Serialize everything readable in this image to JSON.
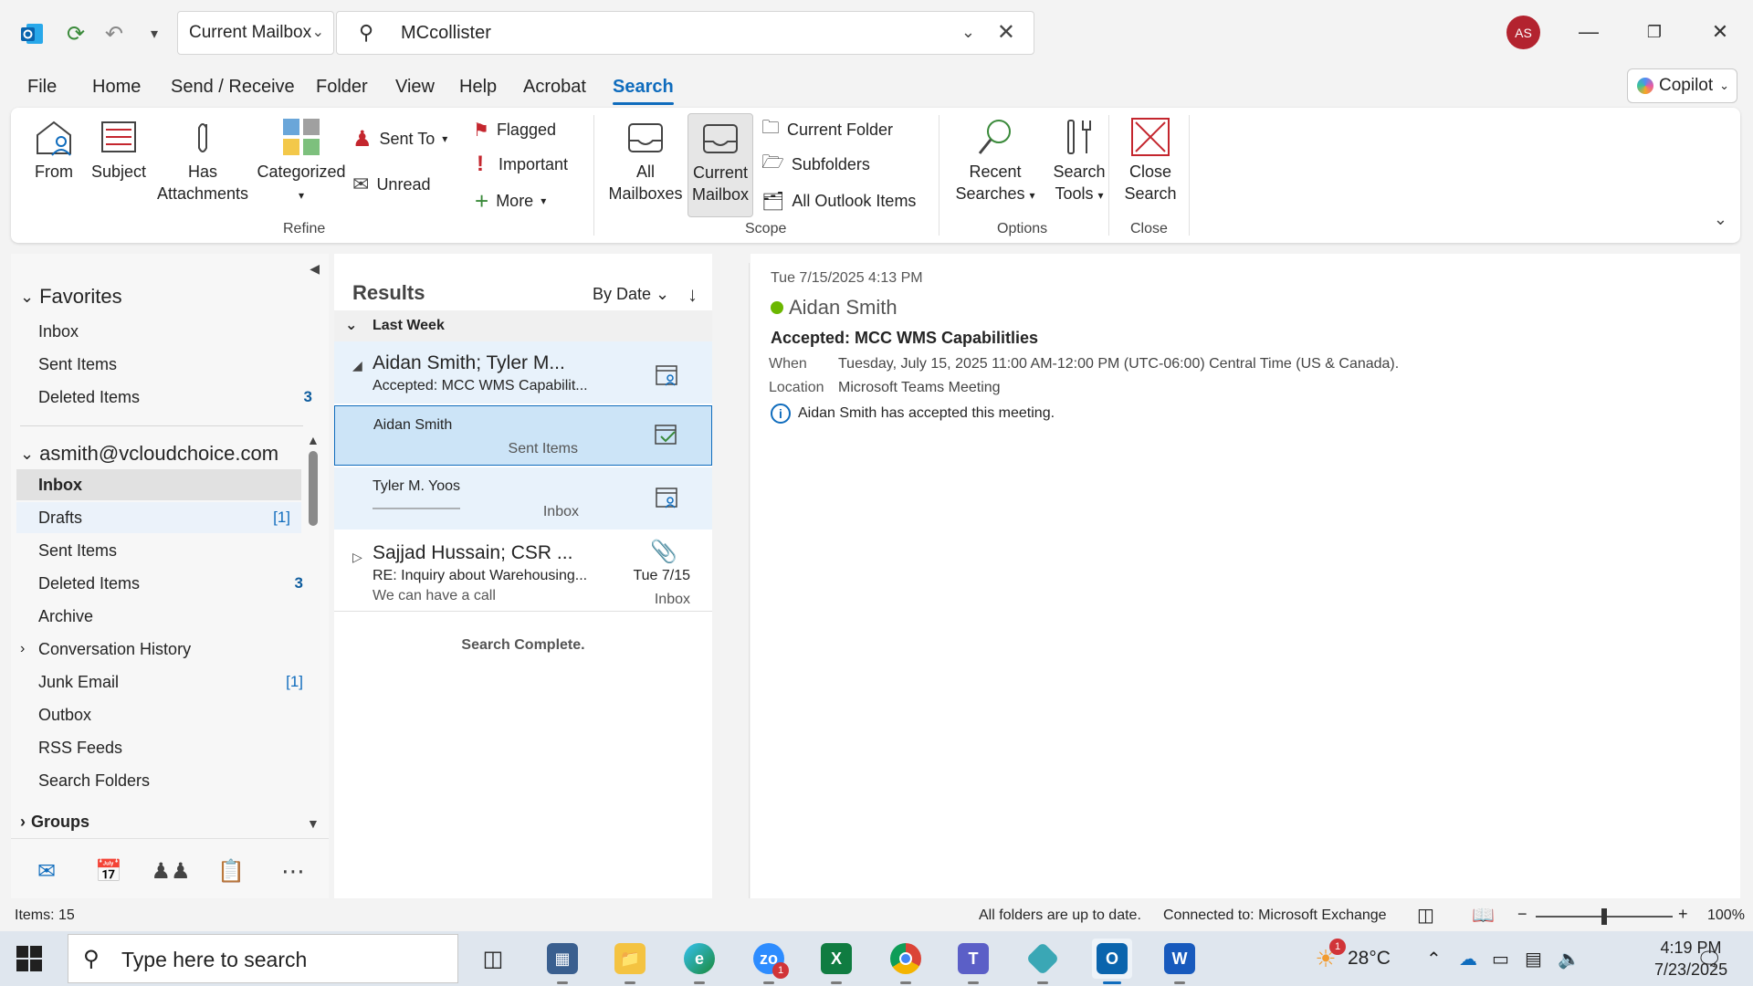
{
  "titlebar": {
    "scope_value": "Current Mailbox",
    "search_value": "MCcollister",
    "avatar_initials": "AS"
  },
  "menu": {
    "tabs": [
      "File",
      "Home",
      "Send / Receive",
      "Folder",
      "View",
      "Help",
      "Acrobat",
      "Search"
    ],
    "active_tab": "Search",
    "copilot_label": "Copilot"
  },
  "ribbon": {
    "refine": {
      "from": "From",
      "subject": "Subject",
      "has_attachments_1": "Has",
      "has_attachments_2": "Attachments",
      "categorized": "Categorized",
      "sent_to": "Sent To",
      "unread": "Unread",
      "flagged": "Flagged",
      "important": "Important",
      "more": "More",
      "label": "Refine"
    },
    "scope": {
      "all_mailboxes_1": "All",
      "all_mailboxes_2": "Mailboxes",
      "current_mailbox_1": "Current",
      "current_mailbox_2": "Mailbox",
      "current_folder": "Current Folder",
      "subfolders": "Subfolders",
      "all_outlook_items": "All Outlook Items",
      "label": "Scope"
    },
    "options": {
      "recent_searches_1": "Recent",
      "recent_searches_2": "Searches",
      "search_tools_1": "Search",
      "search_tools_2": "Tools",
      "label": "Options"
    },
    "close": {
      "close_search_1": "Close",
      "close_search_2": "Search",
      "label": "Close"
    }
  },
  "folders": {
    "favorites_header": "Favorites",
    "favorites": [
      {
        "name": "Inbox",
        "count": ""
      },
      {
        "name": "Sent Items",
        "count": ""
      },
      {
        "name": "Deleted Items",
        "count": "3"
      }
    ],
    "account_header": "asmith@vcloudchoice.com",
    "account": [
      {
        "name": "Inbox",
        "count": ""
      },
      {
        "name": "Drafts",
        "count": "[1]"
      },
      {
        "name": "Sent Items",
        "count": ""
      },
      {
        "name": "Deleted Items",
        "count": "3"
      },
      {
        "name": "Archive",
        "count": ""
      },
      {
        "name": "Conversation History",
        "count": ""
      },
      {
        "name": "Junk Email",
        "count": "[1]"
      },
      {
        "name": "Outbox",
        "count": ""
      },
      {
        "name": "RSS Feeds",
        "count": ""
      },
      {
        "name": "Search Folders",
        "count": ""
      }
    ],
    "groups_header": "Groups"
  },
  "results": {
    "header": "Results",
    "sort_label": "By Date",
    "group": "Last Week",
    "messages": [
      {
        "sender": "Aidan Smith;  Tyler M...",
        "subject": "Accepted: MCC WMS Capabilit..."
      },
      {
        "sender": "Aidan Smith",
        "folder": "Sent Items"
      },
      {
        "sender": "Tyler M. Yoos",
        "subject": "——————",
        "folder": "Inbox"
      },
      {
        "sender": "Sajjad Hussain;  CSR ...",
        "subject": "RE: Inquiry about Warehousing...",
        "preview": "We can have a call",
        "date": "Tue 7/15",
        "folder": "Inbox"
      }
    ],
    "complete": "Search Complete."
  },
  "reading": {
    "date": "Tue 7/15/2025 4:13 PM",
    "sender": "Aidan Smith",
    "subject": "Accepted: MCC WMS Capabilitlies",
    "when_label": "When",
    "when_value": "Tuesday, July 15, 2025 11:00 AM-12:00 PM (UTC-06:00) Central Time (US & Canada).",
    "location_label": "Location",
    "location_value": "Microsoft Teams Meeting",
    "info": "Aidan Smith has accepted this meeting."
  },
  "status": {
    "items": "Items: 15",
    "sync": "All folders are up to date.",
    "connection": "Connected to: Microsoft Exchange",
    "zoom": "100%"
  },
  "taskbar": {
    "search_placeholder": "Type here to search",
    "temperature": "28°C",
    "time": "4:19 PM",
    "date": "7/23/2025",
    "weather_badge": "1",
    "zoom_badge": "1"
  },
  "colors": {
    "accent": "#0f6cbd",
    "avatar": "#b3232f",
    "accepted_dot": "#6bb700",
    "selected_row": "#cce4f7"
  }
}
